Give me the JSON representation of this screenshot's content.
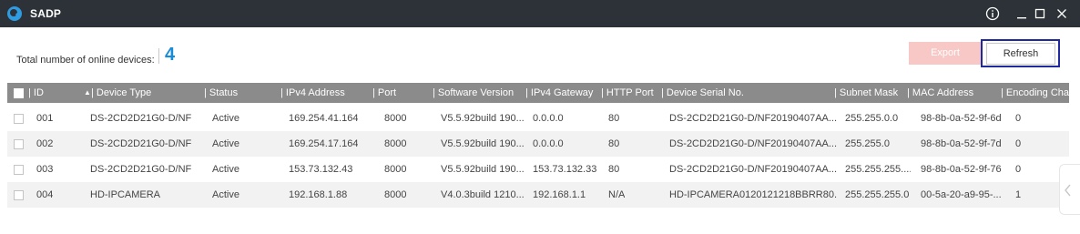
{
  "app": {
    "title": "SADP"
  },
  "summary": {
    "label": "Total number of online devices:",
    "count": "4"
  },
  "toolbar": {
    "export_label": "Export",
    "refresh_label": "Refresh"
  },
  "table": {
    "columns": [
      "ID",
      "Device Type",
      "Status",
      "IPv4 Address",
      "Port",
      "Software Version",
      "IPv4 Gateway",
      "HTTP Port",
      "Device Serial No.",
      "Subnet Mask",
      "MAC Address",
      "Encoding Cha"
    ],
    "rows": [
      [
        "001",
        "DS-2CD2D21G0-D/NF",
        "Active",
        "169.254.41.164",
        "8000",
        "V5.5.92build 190...",
        "0.0.0.0",
        "80",
        "DS-2CD2D21G0-D/NF20190407AA...",
        "255.255.0.0",
        "98-8b-0a-52-9f-6d",
        "0"
      ],
      [
        "002",
        "DS-2CD2D21G0-D/NF",
        "Active",
        "169.254.17.164",
        "8000",
        "V5.5.92build 190...",
        "0.0.0.0",
        "80",
        "DS-2CD2D21G0-D/NF20190407AA...",
        "255.255.0",
        "98-8b-0a-52-9f-7d",
        "0"
      ],
      [
        "003",
        "DS-2CD2D21G0-D/NF",
        "Active",
        "153.73.132.43",
        "8000",
        "V5.5.92build 190...",
        "153.73.132.33",
        "80",
        "DS-2CD2D21G0-D/NF20190407AA...",
        "255.255.255....",
        "98-8b-0a-52-9f-76",
        "0"
      ],
      [
        "004",
        "HD-IPCAMERA",
        "Active",
        "192.168.1.88",
        "8000",
        "V4.0.3build 1210...",
        "192.168.1.1",
        "N/A",
        "HD-IPCAMERA0120121218BBRR80...",
        "255.255.255.0",
        "00-5a-20-a9-95-...",
        "1"
      ]
    ]
  },
  "colors": {
    "titlebar": "#2c3237",
    "header": "#8b8b8b",
    "accent_count": "#1a8bd6",
    "export_disabled": "#f7c8c6",
    "focus_frame": "#1f2a9e"
  },
  "icons": {
    "logo": "sadp-logo-icon",
    "info": "info-icon",
    "minimize": "minimize-icon",
    "maximize": "maximize-icon",
    "close": "close-icon",
    "side": "chevron-left-icon"
  }
}
